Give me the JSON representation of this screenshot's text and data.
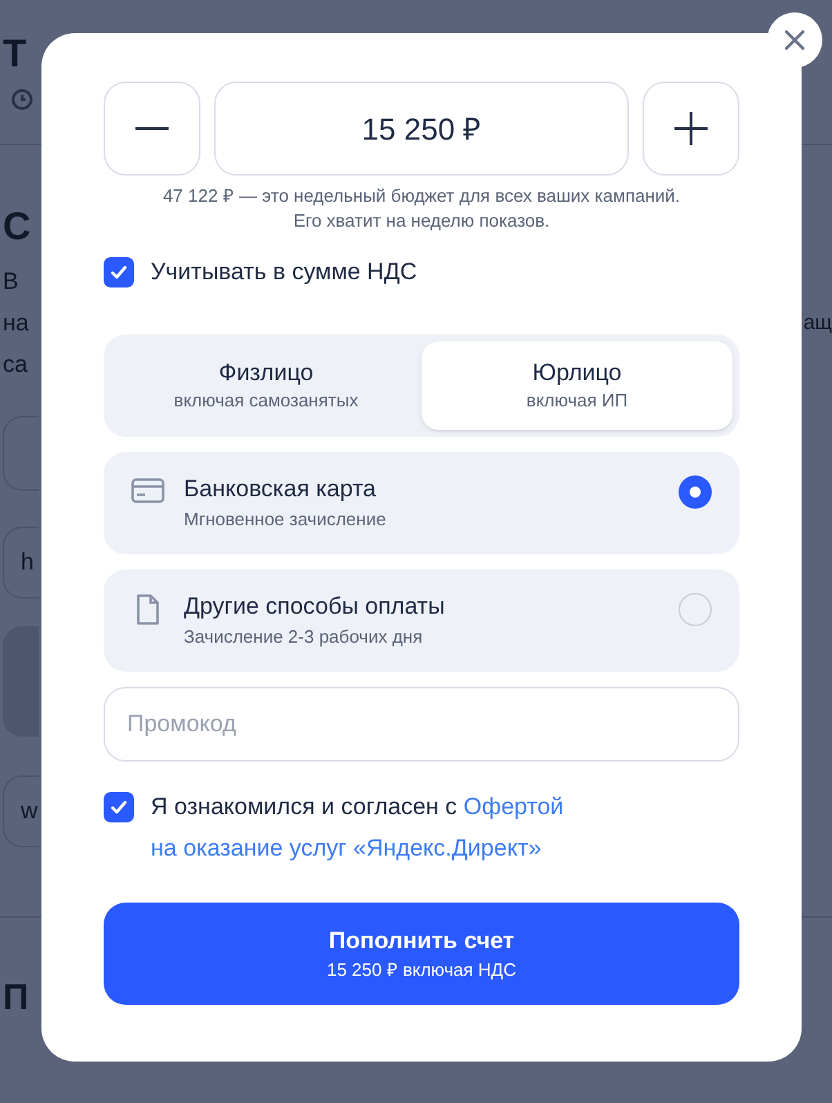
{
  "background": {
    "title": "Т",
    "heading": "С",
    "lines": [
      "В",
      "на",
      "са"
    ],
    "right_fragment": "ащ",
    "fields": [
      "h",
      "w"
    ],
    "footer_heading": "П"
  },
  "modal": {
    "amount": "15 250 ₽",
    "hint": [
      "47 122 ₽ — это недельный бюджет для всех ваших кампаний.",
      "Его хватит на неделю показов."
    ],
    "vat": {
      "label": "Учитывать в сумме НДС",
      "checked": true
    },
    "segments": [
      {
        "label": "Физлицо",
        "sub": "включая самозанятых",
        "selected": false
      },
      {
        "label": "Юрлицо",
        "sub": "включая ИП",
        "selected": true
      }
    ],
    "methods": [
      {
        "kind": "card",
        "label": "Банковская карта",
        "sub": "Мгновенное зачисление",
        "selected": true
      },
      {
        "kind": "document",
        "label": "Другие способы оплаты",
        "sub": "Зачисление 2-3 рабочих дня",
        "selected": false
      }
    ],
    "promo": {
      "placeholder": "Промокод"
    },
    "agreement": {
      "checked": true,
      "text": "Я ознакомился и согласен с ",
      "link": [
        "Офертой",
        "на оказание услуг «Яндекс.Директ»"
      ]
    },
    "submit": {
      "label": "Пополнить счет",
      "sub": "15 250 ₽ включая НДС"
    }
  }
}
